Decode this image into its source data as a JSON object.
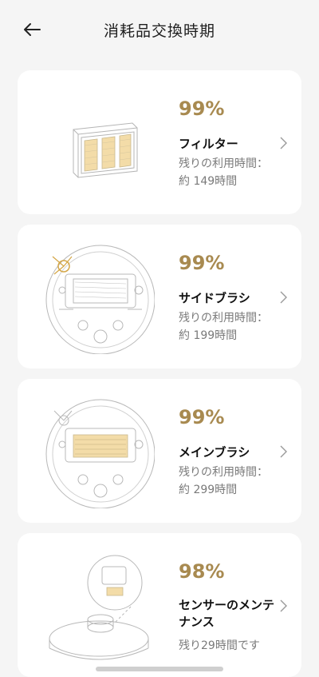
{
  "header": {
    "title": "消耗品交換時期"
  },
  "items": [
    {
      "percent": "99%",
      "name": "フィルター",
      "remaining_line1": "残りの利用時間：",
      "remaining_line2": "約 149時間"
    },
    {
      "percent": "99%",
      "name": "サイドブラシ",
      "remaining_line1": "残りの利用時間：",
      "remaining_line2": "約 199時間"
    },
    {
      "percent": "99%",
      "name": "メインブラシ",
      "remaining_line1": "残りの利用時間：",
      "remaining_line2": "約 299時間"
    },
    {
      "percent": "98%",
      "name": "センサーのメンテナンス",
      "remaining_line1": "残り29時間です",
      "remaining_line2": ""
    }
  ],
  "colors": {
    "accent": "#a88a50",
    "highlight": "#f3dca8",
    "background": "#f5f5f5"
  }
}
